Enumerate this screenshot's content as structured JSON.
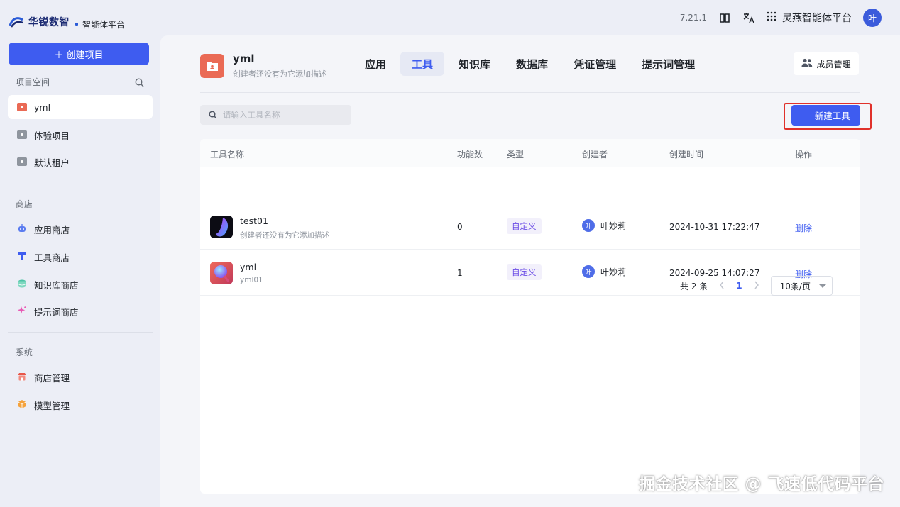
{
  "header": {
    "brand": "华锐数智",
    "subtitle": "智能体平台",
    "version": "7.21.1",
    "platform_label": "灵燕智能体平台",
    "user_initial": "叶"
  },
  "sidebar": {
    "create_label": "创建项目",
    "project_space_label": "项目空间",
    "projects": [
      {
        "label": "yml",
        "color": "#ea6a55"
      },
      {
        "label": "体验项目",
        "color": "#8f959e"
      },
      {
        "label": "默认租户",
        "color": "#8f959e"
      }
    ],
    "store_label": "商店",
    "store_items": [
      {
        "label": "应用商店",
        "icon": "robot-icon"
      },
      {
        "label": "工具商店",
        "icon": "tool-icon"
      },
      {
        "label": "知识库商店",
        "icon": "database-icon"
      },
      {
        "label": "提示词商店",
        "icon": "sparkle-icon"
      }
    ],
    "system_label": "系统",
    "system_items": [
      {
        "label": "商店管理",
        "icon": "store-icon"
      },
      {
        "label": "模型管理",
        "icon": "cube-icon"
      }
    ]
  },
  "project": {
    "name": "yml",
    "description": "创建者还没有为它添加描述"
  },
  "tabs": [
    {
      "label": "应用",
      "active": false
    },
    {
      "label": "工具",
      "active": true
    },
    {
      "label": "知识库",
      "active": false
    },
    {
      "label": "数据库",
      "active": false
    },
    {
      "label": "凭证管理",
      "active": false
    },
    {
      "label": "提示词管理",
      "active": false
    }
  ],
  "member_button": "成员管理",
  "search": {
    "placeholder": "请输入工具名称",
    "value": ""
  },
  "new_tool_label": "新建工具",
  "table": {
    "columns": [
      "工具名称",
      "功能数",
      "类型",
      "创建者",
      "创建时间",
      "操作"
    ],
    "rows": [
      {
        "name": "test01",
        "desc": "创建者还没有为它添加描述",
        "count": "0",
        "type": "自定义",
        "creator": "叶妙莉",
        "creator_initial": "叶",
        "created": "2024-10-31 17:22:47",
        "action": "删除"
      },
      {
        "name": "yml",
        "desc": "yml01",
        "count": "1",
        "type": "自定义",
        "creator": "叶妙莉",
        "creator_initial": "叶",
        "created": "2024-09-25 14:07:27",
        "action": "删除"
      }
    ]
  },
  "pagination": {
    "total_text": "共 2 条",
    "current_page": "1",
    "page_size": "10条/页"
  },
  "watermark": "掘金技术社区 @ 飞速低代码平台",
  "colors": {
    "accent": "#3e5cf0",
    "highlight": "#e0312b",
    "tag_bg": "#f2f0fb",
    "tag_text": "#6b4ce6"
  }
}
